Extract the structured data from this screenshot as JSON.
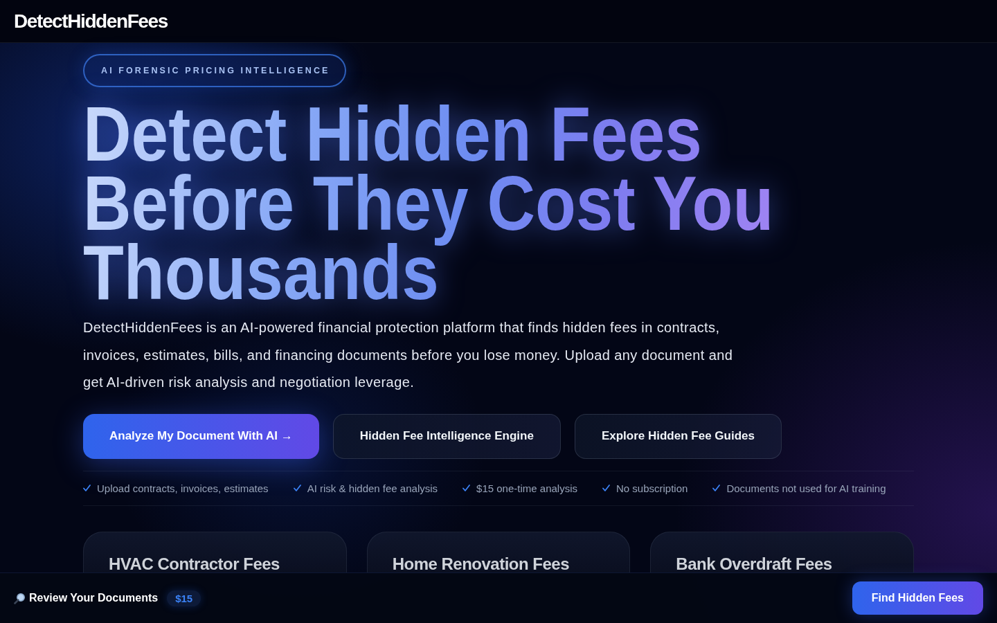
{
  "header": {
    "logo": "DetectHiddenFees"
  },
  "hero": {
    "badge": "AI FORENSIC PRICING INTELLIGENCE",
    "headline_lines": [
      "Detect Hidden Fees",
      "Before They Cost You",
      "Thousands"
    ],
    "description": "DetectHiddenFees is an AI-powered financial protection platform that finds hidden fees in contracts, invoices, estimates, bills, and financing documents before you lose money. Upload any document and get AI-driven risk analysis and negotiation leverage.",
    "buttons": [
      {
        "label": "Analyze My Document With AI →",
        "kind": "primary"
      },
      {
        "label": "Hidden Fee Intelligence Engine",
        "kind": "secondary"
      },
      {
        "label": "Explore Hidden Fee Guides",
        "kind": "secondary"
      }
    ],
    "features": [
      "Upload contracts, invoices, estimates",
      "AI risk & hidden fee analysis",
      "$15 one-time analysis",
      "No subscription",
      "Documents not used for AI training"
    ]
  },
  "cards": [
    {
      "title": "HVAC Contractor Fees"
    },
    {
      "title": "Home Renovation Fees"
    },
    {
      "title": "Bank Overdraft Fees"
    }
  ],
  "bottom_bar": {
    "label": "Review Your Documents",
    "price": "$15",
    "button": "Find Hidden Fees"
  }
}
